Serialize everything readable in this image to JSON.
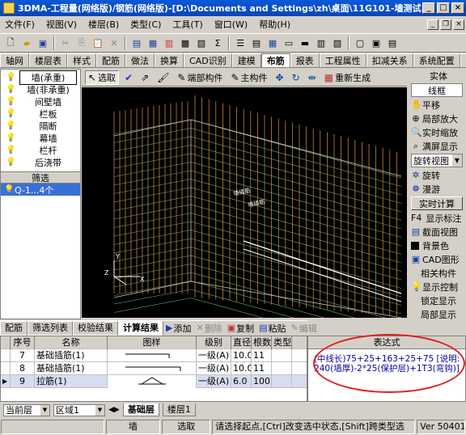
{
  "window": {
    "title": "3DMA-工程量(网络版)/钢筋(网络版)-[D:\\Documents and Settings\\zh\\桌面\\11G101-墙测试...",
    "minimize": "_",
    "maximize": "□",
    "close": "×"
  },
  "menu": {
    "items": [
      "文件(F)",
      "视图(V)",
      "楼层(B)",
      "类型(C)",
      "工具(T)",
      "窗口(W)",
      "帮助(H)"
    ]
  },
  "tabs": [
    "轴网",
    "楼层表",
    "样式",
    "配筋",
    "做法",
    "换算",
    "CAD识别",
    "建模",
    "布筋",
    "报表",
    "工程属性",
    "扣减关系",
    "系统配置",
    "说i"
  ],
  "active_tab": "布筋",
  "left_panel": {
    "items": [
      "墙(承重)",
      "墙(非承重)",
      "间壁墙",
      "栏板",
      "隔断",
      "幕墙",
      "栏杆",
      "后浇带"
    ],
    "filter_label": "筛选",
    "filtered_item": "Q-1...4个"
  },
  "canvas_toolbar": {
    "select": "选取",
    "end_member": "端部构件",
    "main_member": "主构件",
    "regenerate": "重新生成"
  },
  "viewport": {
    "label1": "墙插筋",
    "label2": "墙插筋",
    "axis_y": "Y",
    "axis_z": "Z",
    "axis_x": "X"
  },
  "right_panel": {
    "solid": "实体",
    "wireframe": "线框",
    "pan": "平移",
    "local_zoom": "局部放大",
    "realtime_zoom": "实时缩放",
    "fit_screen": "满屏显示",
    "rotate_view": "旋转视图",
    "rotate": "旋转",
    "roam": "漫游",
    "realtime_calc": "实时计算",
    "f4_label": "F4",
    "show_marks": "显示标注",
    "section_view": "截面视图",
    "bg_color": "背景色",
    "cad_graphic": "CAD图形",
    "related": "相关构件",
    "show_control": "显示控制",
    "lock_display": "锁定显示",
    "local_display": "局部显示"
  },
  "bottom_tabs": [
    "配筋",
    "筛选列表",
    "校验结果",
    "计算结果"
  ],
  "bottom_active_tab": "计算结果",
  "bottom_actions": {
    "add": "添加",
    "delete": "删除",
    "copy": "复制",
    "paste": "粘贴",
    "edit": "编辑"
  },
  "table": {
    "headers": [
      "序号",
      "名称",
      "图样",
      "级别",
      "直径",
      "根数",
      "类型"
    ],
    "rows": [
      {
        "no": "7",
        "name": "基础插筋(1)",
        "grade": "一级(A)",
        "dia": "10.0",
        "count": "11",
        "type": ""
      },
      {
        "no": "8",
        "name": "基础插筋(1)",
        "grade": "一级(A)",
        "dia": "10.0",
        "count": "11",
        "type": ""
      },
      {
        "no": "9",
        "name": "拉筋(1)",
        "grade": "一级(A)",
        "dia": "6.0",
        "count": "100",
        "type": ""
      }
    ]
  },
  "expression": {
    "header": "表达式",
    "text": "(中线长)75+25+163+25+75 [说明: 240(墙厚)-2*25(保护层)+1T3(弯钩)]"
  },
  "floor_bar": {
    "current_floor": "当前层",
    "region": "区域1",
    "tab_base": "基础层",
    "tab_floor1": "楼层1"
  },
  "status": {
    "element": "墙",
    "mode": "选取",
    "hint": "请选择起点,[Ctrl]改变选中状态,[Shift]跨类型选",
    "version": "Ver 50401"
  },
  "colors": {
    "titlebar": "#0a58d8",
    "viewport_bg": "#000000",
    "rebar_orange": "#d89a3a",
    "rebar_green": "#6fb07a",
    "highlight_ring": "#e02020"
  }
}
